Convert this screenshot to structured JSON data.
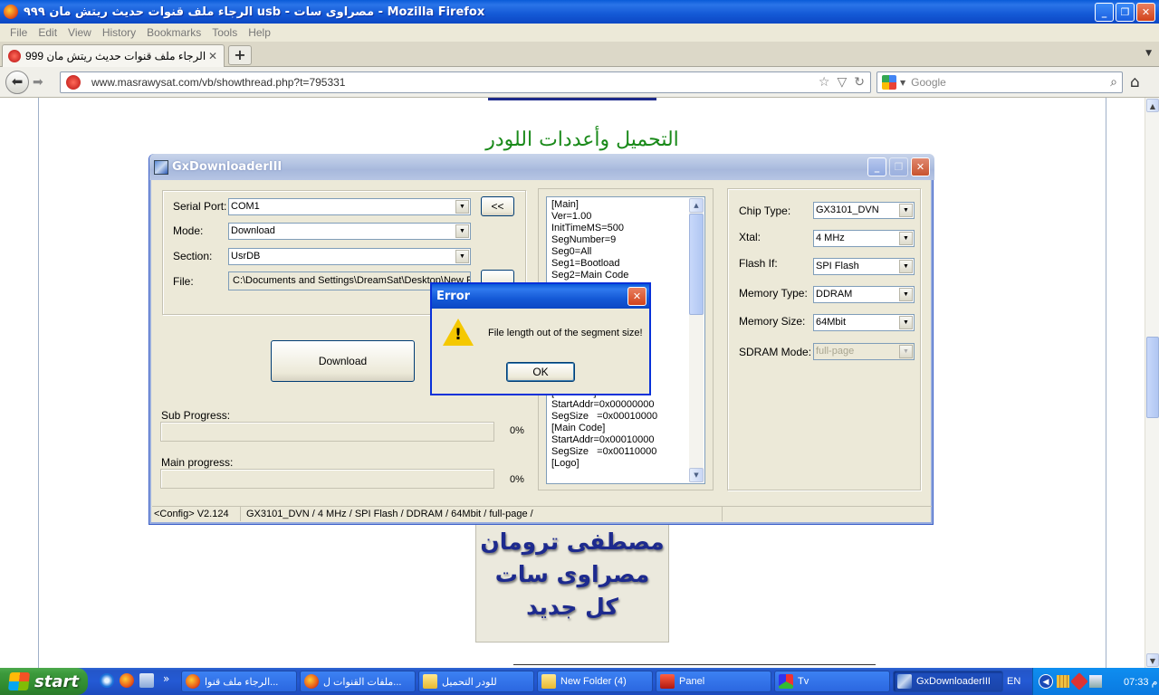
{
  "browser": {
    "title": "الرجاء ملف قنوات حديث ريتش مان ٩٩٩ usb - مصراوى سات - Mozilla Firefox",
    "menu": [
      "File",
      "Edit",
      "View",
      "History",
      "Bookmarks",
      "Tools",
      "Help"
    ],
    "tab_title": "الرجاء ملف قنوات حديث ريتش مان 999 ...",
    "url": "www.masrawysat.com/vb/showthread.php?t=795331",
    "search_placeholder": "Google"
  },
  "webpage": {
    "heading": "التحميل وأعددات اللودر",
    "signature": [
      "مصطفى ترومان",
      "مصراوى سات",
      "كل جديد"
    ]
  },
  "gx": {
    "title": "GxDownloaderIII",
    "serial_port_label": "Serial Port:",
    "serial_port_value": "COM1",
    "collapse_button": "<<",
    "mode_label": "Mode:",
    "mode_value": "Download",
    "section_label": "Section:",
    "section_value": "UsrDB",
    "file_label": "File:",
    "file_value": "C:\\Documents and Settings\\DreamSat\\Desktop\\New Fo",
    "download_button": "Download",
    "sub_progress_label": "Sub Progress:",
    "sub_progress_pct": "0%",
    "sub_progress_value": 0,
    "main_progress_label": "Main progress:",
    "main_progress_pct": "0%",
    "main_progress_value": 0,
    "config_lines": [
      "[Main]",
      "Ver=1.00",
      "InitTimeMS=500",
      "SegNumber=9",
      "Seg0=All",
      "Seg1=Bootload",
      "Seg2=Main Code",
      "",
      "",
      "",
      "",
      "",
      "",
      "",
      "",
      "",
      "",
      "",
      "",
      "",
      "",
      "",
      "",
      ""
    ],
    "config_tail": [
      "[Bootload]",
      "StartAddr=0x00000000",
      "SegSize   =0x00010000",
      "[Main Code]",
      "StartAddr=0x00010000",
      "SegSize   =0x00110000",
      "[Logo]"
    ],
    "chip_type_label": "Chip Type:",
    "chip_type_value": "GX3101_DVN",
    "xtal_label": "Xtal:",
    "xtal_value": "4 MHz",
    "flash_if_label": "Flash If:",
    "flash_if_value": "SPI Flash",
    "memory_type_label": "Memory Type:",
    "memory_type_value": "DDRAM",
    "memory_size_label": "Memory Size:",
    "memory_size_value": "64Mbit",
    "sdram_mode_label": "SDRAM Mode:",
    "sdram_mode_value": "full-page",
    "status_config": "<Config> V2.124",
    "status_summary": "GX3101_DVN / 4 MHz / SPI Flash / DDRAM / 64Mbit / full-page /"
  },
  "error_dialog": {
    "title": "Error",
    "message": "File length out of the segment size!",
    "ok_label": "OK"
  },
  "taskbar": {
    "start_label": "start",
    "tasks": [
      {
        "label": "الرجاء ملف قنوا..."
      },
      {
        "label": "ملفات القنوات ل..."
      },
      {
        "label": "للودر التحميل"
      },
      {
        "label": "New Folder (4)"
      },
      {
        "label": "Panel"
      },
      {
        "label": "Tv"
      },
      {
        "label": "GxDownloaderIII"
      }
    ],
    "language": "EN",
    "clock": "07:33 م"
  },
  "colors": {
    "xp_blue": "#0a5bd8",
    "start_green": "#3c9a3c",
    "heading_green": "#1a8a1a",
    "signature_blue": "#1d2a8e"
  }
}
